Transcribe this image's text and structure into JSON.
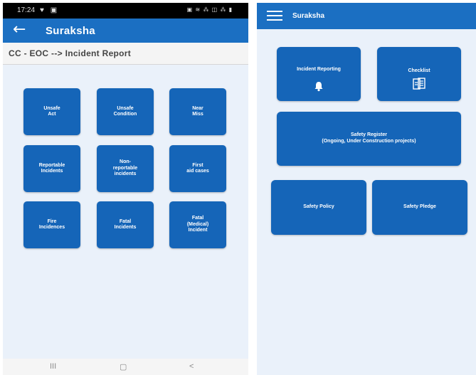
{
  "left": {
    "status": {
      "time": "17:24",
      "left_icons": "♥ ▣",
      "right_icons": "▣ ≋ ⁂ ◫ ⁂ ▮"
    },
    "appbar": {
      "title": "Suraksha"
    },
    "breadcrumb": "CC - EOC --> Incident Report",
    "tiles": [
      {
        "label": "Unsafe\nAct"
      },
      {
        "label": "Unsafe\nCondition"
      },
      {
        "label": "Near\nMiss"
      },
      {
        "label": "Reportable\nIncidents"
      },
      {
        "label": "Non-\nreportable\nincidents"
      },
      {
        "label": "First\naid cases"
      },
      {
        "label": "Fire\nIncidences"
      },
      {
        "label": "Fatal\nIncidents"
      },
      {
        "label": "Fatal\n(Medical)\nIncident"
      }
    ],
    "navbar": {
      "recents": "III",
      "home": "▢",
      "back": "<"
    }
  },
  "right": {
    "appbar": {
      "title": "Suraksha"
    },
    "tiles": {
      "incident_reporting": "Incident Reporting",
      "checklist": "Checklist",
      "safety_register": "Safety Register\n(Ongoing, Under Construction projects)",
      "safety_policy": "Safety Policy",
      "safety_pledge": "Safety Pledge"
    }
  },
  "colors": {
    "appbar": "#1b6fc2",
    "tile": "#1565b8",
    "background": "#eaf1fa"
  },
  "icons": {
    "back": "arrow-left-icon",
    "menu": "hamburger-menu-icon",
    "bell": "bell-icon",
    "checklist": "clipboard-icon"
  }
}
